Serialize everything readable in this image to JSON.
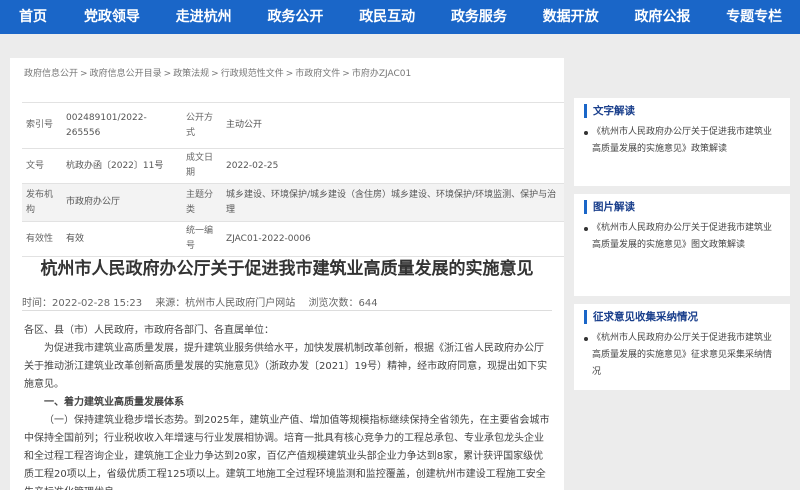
{
  "nav": {
    "items": [
      "首页",
      "党政领导",
      "走进杭州",
      "政务公开",
      "政民互动",
      "政务服务",
      "数据开放",
      "政府公报",
      "专题专栏"
    ]
  },
  "breadcrumb": {
    "items": [
      "政府信息公开",
      "政府信息公开目录",
      "政策法规",
      "行政规范性文件",
      "市政府文件",
      "市府办ZJAC01"
    ],
    "separator": ">"
  },
  "info": {
    "index_label": "索引号",
    "index_value": "002489101/2022-265556",
    "disclosure_label": "公开方式",
    "disclosure_value": "主动公开",
    "docno_label": "文号",
    "docno_value": "杭政办函〔2022〕11号",
    "date_label": "成文日期",
    "date_value": "2022-02-25",
    "issuer_label": "发布机构",
    "issuer_value": "市政府办公厅",
    "subject_label": "主题分类",
    "subject_value": "城乡建设、环境保护/城乡建设（含住房）城乡建设、环境保护/环境监测、保护与治理",
    "validity_label": "有效性",
    "validity_value": "有效",
    "code_label": "统一编号",
    "code_value": "ZJAC01-2022-0006"
  },
  "article": {
    "title": "杭州市人民政府办公厅关于促进我市建筑业高质量发展的实施意见",
    "publish_time": "时间：2022-02-28 15:23",
    "source": "来源：杭州市人民政府门户网站",
    "views": "浏览次数：644",
    "salutation": "各区、县（市）人民政府，市政府各部门、各直属单位：",
    "para1": "为促进我市建筑业高质量发展，提升建筑业服务供给水平，加快发展机制改革创新，根据《浙江省人民政府办公厅关于推动浙江建筑业改革创新高质量发展的实施意见》（浙政办发〔2021〕19号）精神，经市政府同意，现提出如下实施意见。",
    "heading1": "一、着力建筑业高质量发展体系",
    "para2": "（一）保持建筑业稳步增长态势。到2025年，建筑业产值、增加值等规模指标继续保持全省领先，在主要省会城市中保持全国前列；行业税收收入年增速与行业发展相协调。培育一批具有核心竞争力的工程总承包、专业承包龙头企业和全过程工程咨询企业，建筑施工企业力争达到20家，百亿产值规模建筑业头部企业力争达到8家，累计获评国家级优质工程20项以上，省级优质工程125项以上。建筑工地施工全过程环境监测和监控覆盖，创建杭州市建设工程施工安全生产标准化管理优良"
  },
  "sidebar": {
    "panel1_title": "文字解读",
    "panel1_item": "《杭州市人民政府办公厅关于促进我市建筑业高质量发展的实施意见》政策解读",
    "panel2_title": "图片解读",
    "panel2_item": "《杭州市人民政府办公厅关于促进我市建筑业高质量发展的实施意见》图文政策解读",
    "panel3_title": "征求意见收集采纳情况",
    "panel3_item": "《杭州市人民政府办公厅关于促进我市建筑业高质量发展的实施意见》征求意见采集采纳情况"
  }
}
